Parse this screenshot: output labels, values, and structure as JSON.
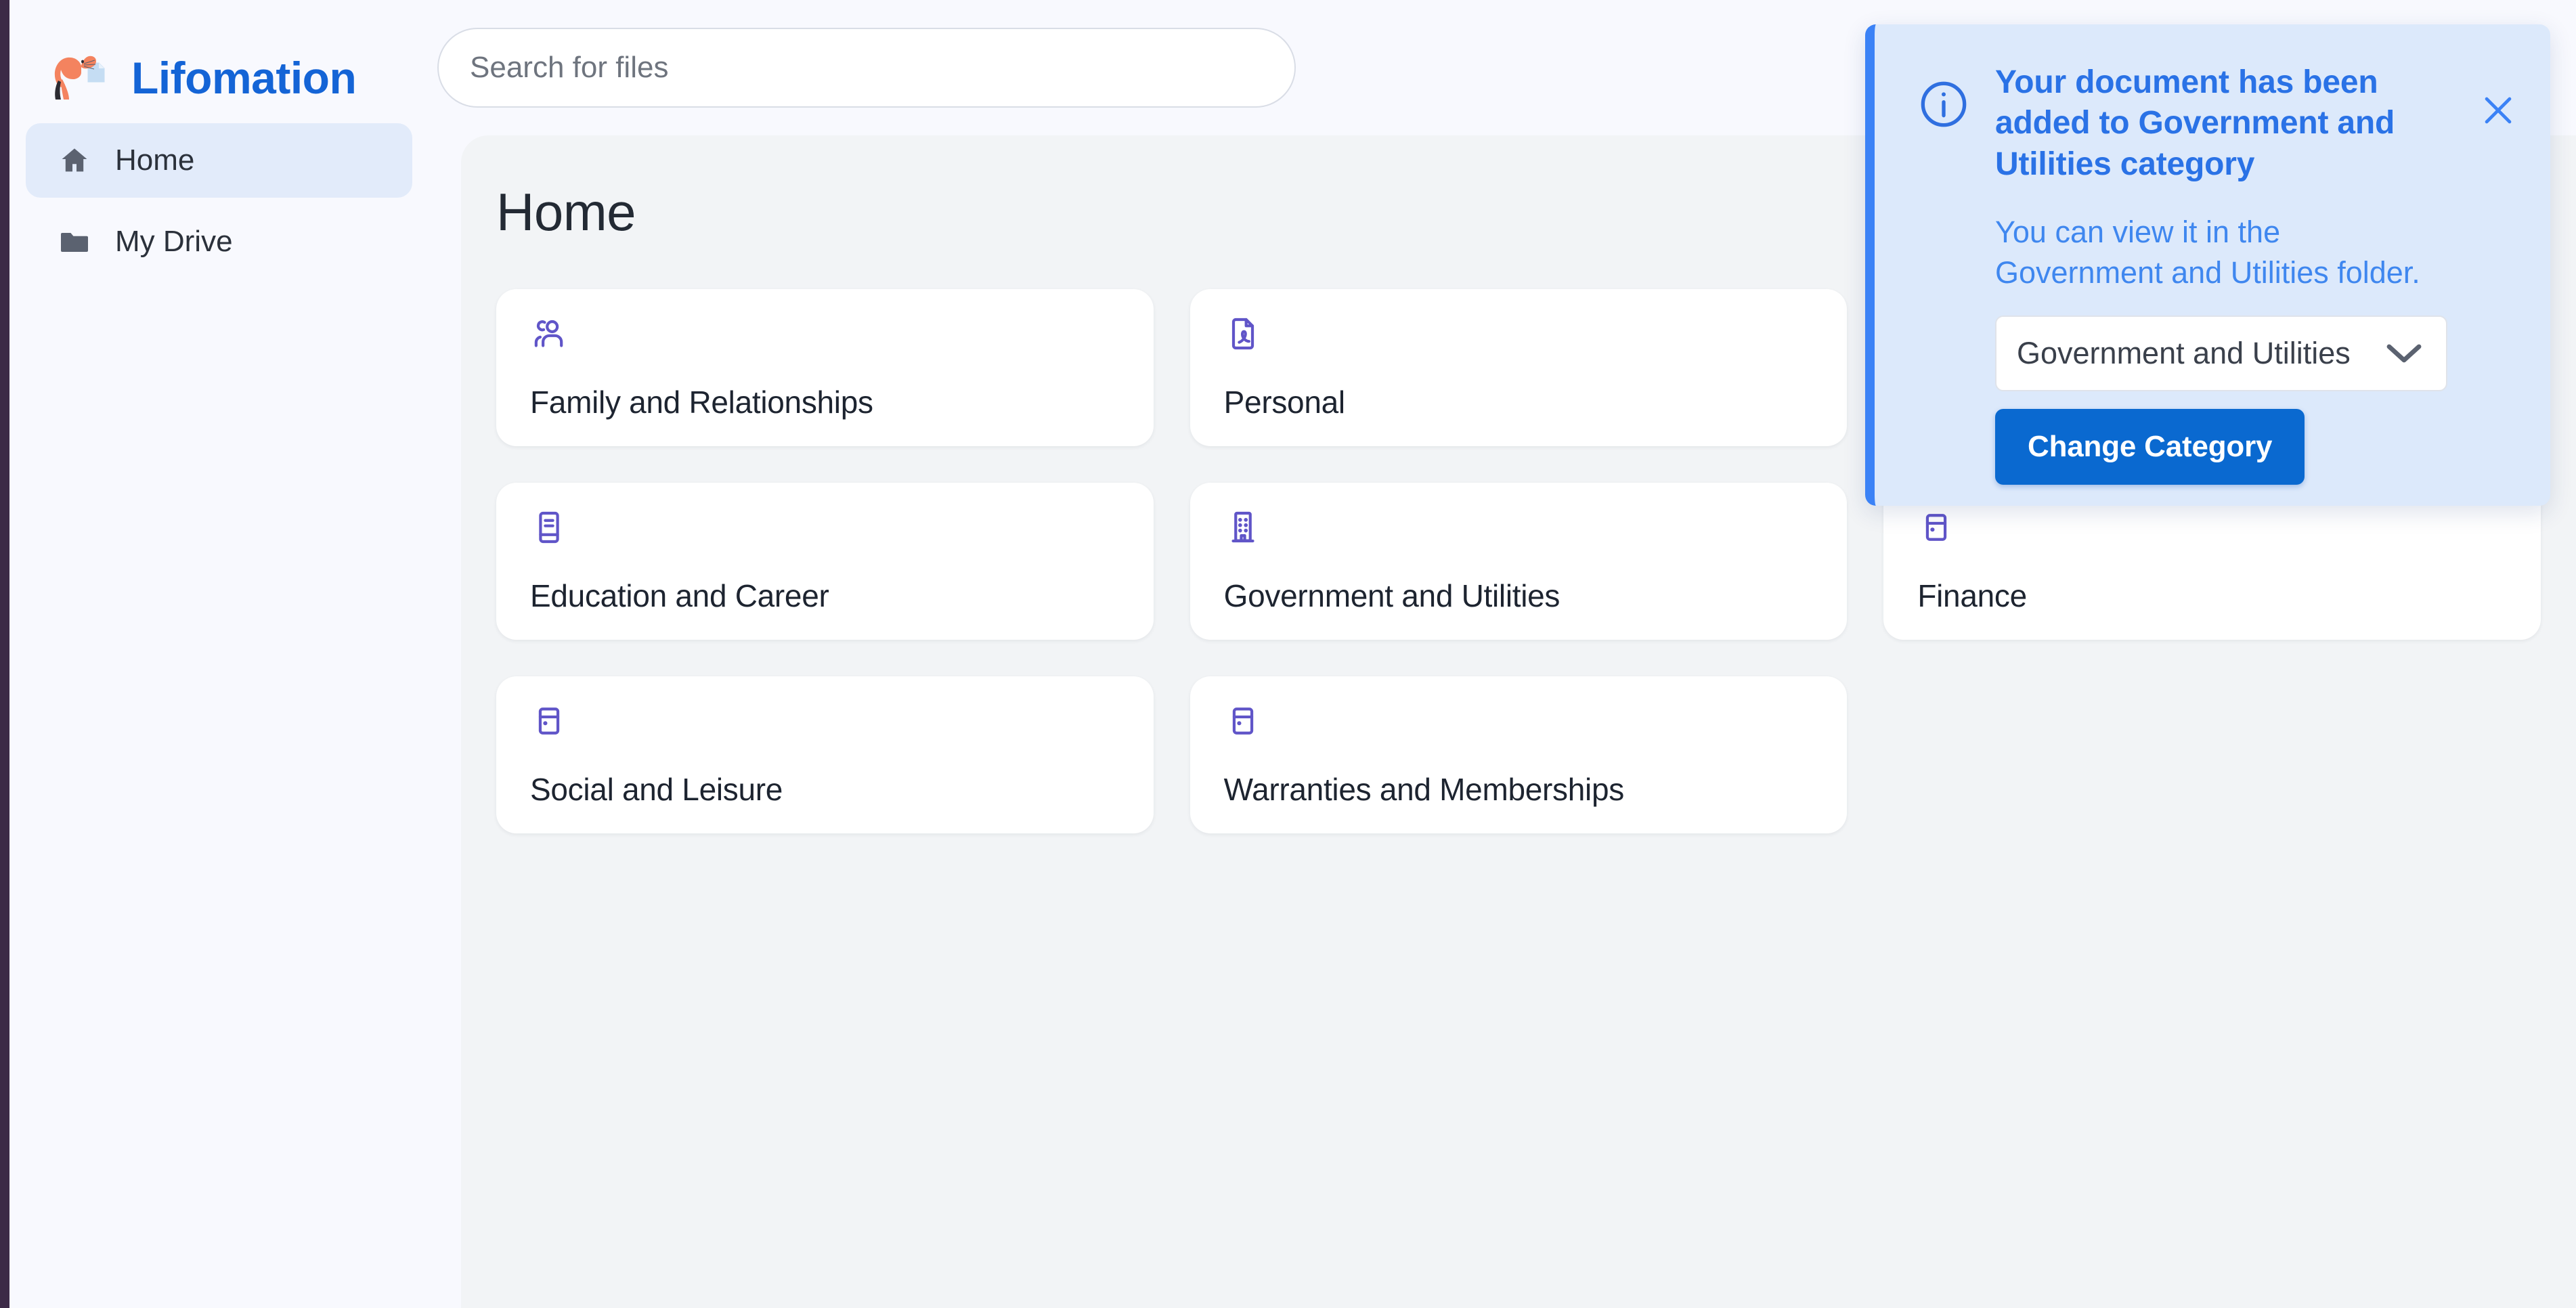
{
  "app": {
    "brand_name": "Lifomation",
    "logo_icon": "cat-with-document-logo"
  },
  "sidebar": {
    "items": [
      {
        "label": "Home",
        "icon": "home-icon",
        "active": true
      },
      {
        "label": "My Drive",
        "icon": "folder-icon",
        "active": false
      }
    ]
  },
  "search": {
    "placeholder": "Search for files",
    "value": "",
    "icon": "search-icon"
  },
  "main": {
    "page_title": "Home",
    "categories": [
      {
        "label": "Family and Relationships",
        "icon": "users-icon"
      },
      {
        "label": "Personal",
        "icon": "pdf-file-icon"
      },
      {
        "label": "",
        "icon": ""
      },
      {
        "label": "Education and Career",
        "icon": "book-icon"
      },
      {
        "label": "Government and Utilities",
        "icon": "building-icon"
      },
      {
        "label": "Finance",
        "icon": "card-icon"
      },
      {
        "label": "Social and Leisure",
        "icon": "card-icon"
      },
      {
        "label": "Warranties and Memberships",
        "icon": "card-icon"
      },
      {
        "label": "",
        "icon": ""
      }
    ]
  },
  "toast": {
    "icon": "info-circle-icon",
    "title": "Your document has been added to Government and Utilities category",
    "message": "You can view it in the Government and Utilities folder.",
    "select_value": "Government and Utilities",
    "select_icon": "chevron-down-icon",
    "button_label": "Change Category",
    "close_icon": "close-icon"
  },
  "colors": {
    "brand_blue": "#1464d6",
    "accent_purple": "#6055c8",
    "toast_bg": "#dce9fb",
    "toast_border": "#3b82f6",
    "toast_title": "#2a72e6",
    "button_blue": "#0a69d0",
    "sidebar_active": "#e2ebfa"
  }
}
